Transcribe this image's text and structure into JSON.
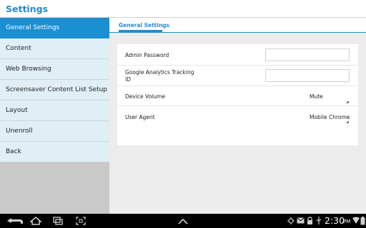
{
  "app": {
    "title": "Settings"
  },
  "sidebar": {
    "items": [
      {
        "label": "General Settings",
        "active": true
      },
      {
        "label": "Content"
      },
      {
        "label": "Web Browsing"
      },
      {
        "label": "Screensaver Content List Setup"
      },
      {
        "label": "Layout"
      },
      {
        "label": "Unenroll"
      },
      {
        "label": "Back"
      }
    ]
  },
  "main": {
    "tab": {
      "label": "General Settings"
    },
    "settings": {
      "admin_password": {
        "label": "Admin Password",
        "value": ""
      },
      "analytics_id": {
        "label": "Google Analytics Tracking\nID",
        "value": ""
      },
      "device_volume": {
        "label": "Device Volume",
        "value": "Mute"
      },
      "user_agent": {
        "label": "User Agent",
        "value": "Mobile Chrome"
      }
    }
  },
  "status_bar": {
    "time": "2:30",
    "ampm": "PM",
    "nav_icons": [
      "back-icon",
      "home-icon",
      "recent-apps-icon",
      "screenshot-icon",
      "up-chevron-icon"
    ],
    "status_icons": [
      "debug-icon",
      "mail-icon",
      "lock-icon",
      "usb-icon",
      "wifi-icon",
      "battery-icon"
    ]
  },
  "colors": {
    "accent": "#1b8fd2",
    "sidebar_bg": "#e0eff5",
    "content_bg": "#ececec"
  }
}
